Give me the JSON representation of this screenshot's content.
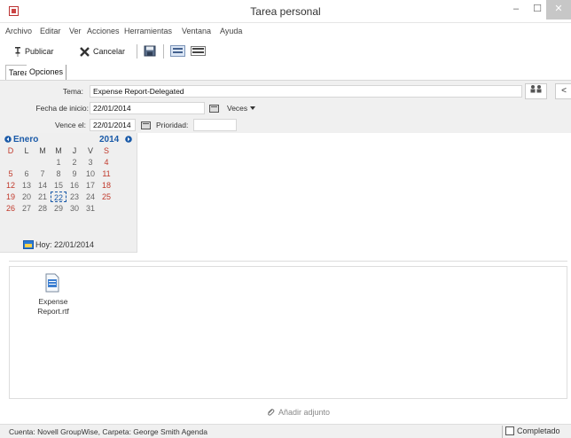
{
  "window": {
    "title": "Tarea personal",
    "min_glyph": "–",
    "max_glyph": "☐",
    "close_glyph": "✕"
  },
  "menu": [
    "Archivo",
    "Editar",
    "Ver",
    "Acciones",
    "Herramientas",
    "Ventana",
    "Ayuda"
  ],
  "toolbar": {
    "publish_label": "Publicar",
    "cancel_label": "Cancelar"
  },
  "tabs": [
    "Tarea",
    "Opciones"
  ],
  "form": {
    "subject_label": "Tema:",
    "subject_value": "Expense Report-Delegated",
    "start_label": "Fecha de inicio:",
    "start_value": "22/01/2014",
    "times_label": "Veces",
    "due_label": "Vence el:",
    "due_value": "22/01/2014",
    "priority_label": "Prioridad:",
    "priority_value": ""
  },
  "calendar": {
    "month": "Enero",
    "year": "2014",
    "day_headers": [
      "D",
      "L",
      "M",
      "M",
      "J",
      "V",
      "S"
    ],
    "weeks": [
      [
        "",
        "",
        "",
        "1",
        "2",
        "3",
        "4"
      ],
      [
        "5",
        "6",
        "7",
        "8",
        "9",
        "10",
        "11"
      ],
      [
        "12",
        "13",
        "14",
        "15",
        "16",
        "17",
        "18"
      ],
      [
        "19",
        "20",
        "21",
        "22",
        "23",
        "24",
        "25"
      ],
      [
        "26",
        "27",
        "28",
        "29",
        "30",
        "31",
        ""
      ]
    ],
    "selected_day": "22",
    "today_label": "Hoy: 22/01/2014"
  },
  "attachments": [
    {
      "name_line1": "Expense",
      "name_line2": "Report.rtf"
    }
  ],
  "add_attachment_label": "Añadir adjunto",
  "status": {
    "text": "Cuenta: Novell GroupWise,  Carpeta: George Smith Agenda",
    "completed_label": "Completado"
  },
  "colors": {
    "accent": "#1a5aa8",
    "weekend": "#c0392b"
  }
}
